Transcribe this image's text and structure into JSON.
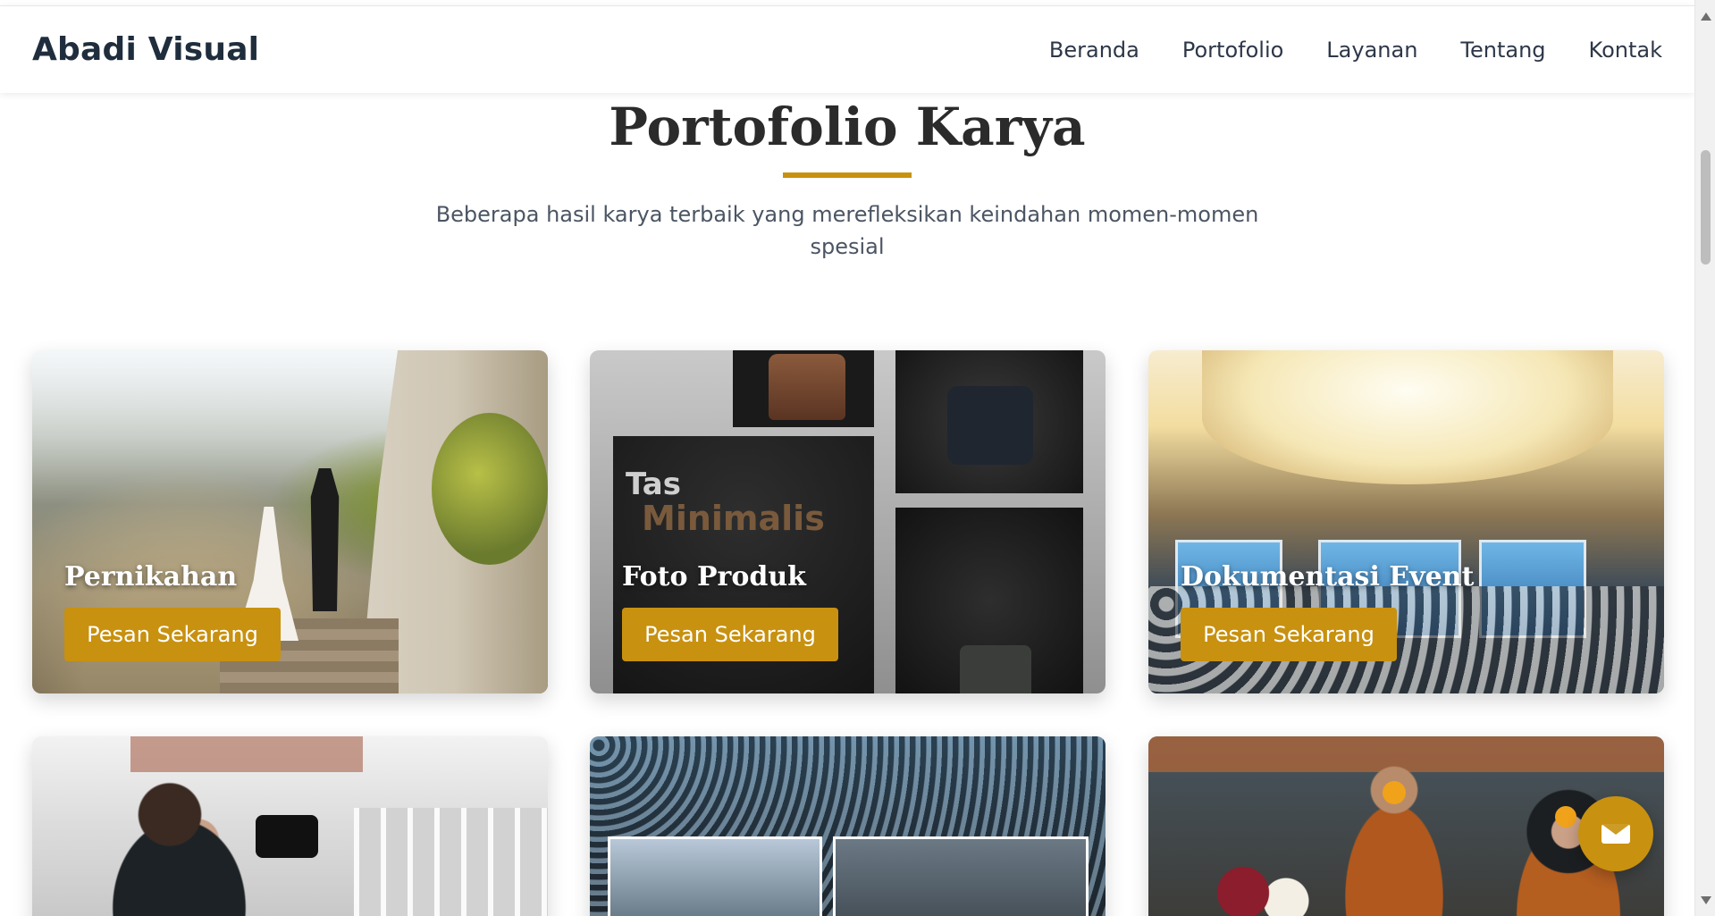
{
  "brand": "Abadi Visual",
  "nav": [
    "Beranda",
    "Portofolio",
    "Layanan",
    "Tentang",
    "Kontak"
  ],
  "section": {
    "title": "Portofolio Karya",
    "subtitle": "Beberapa hasil karya terbaik yang merefleksikan keindahan momen-momen spesial"
  },
  "cards": [
    {
      "title": "Pernikahan",
      "button": "Pesan Sekarang"
    },
    {
      "title": "Foto Produk",
      "button": "Pesan Sekarang",
      "image_text": [
        "Tas",
        "Minimalis"
      ]
    },
    {
      "title": "Dokumentasi Event",
      "button": "Pesan Sekarang"
    }
  ],
  "floating_button": {
    "icon": "envelope-icon"
  },
  "colors": {
    "accent": "#c8910f",
    "heading": "#2b2b2b",
    "text": "#4b5563"
  }
}
